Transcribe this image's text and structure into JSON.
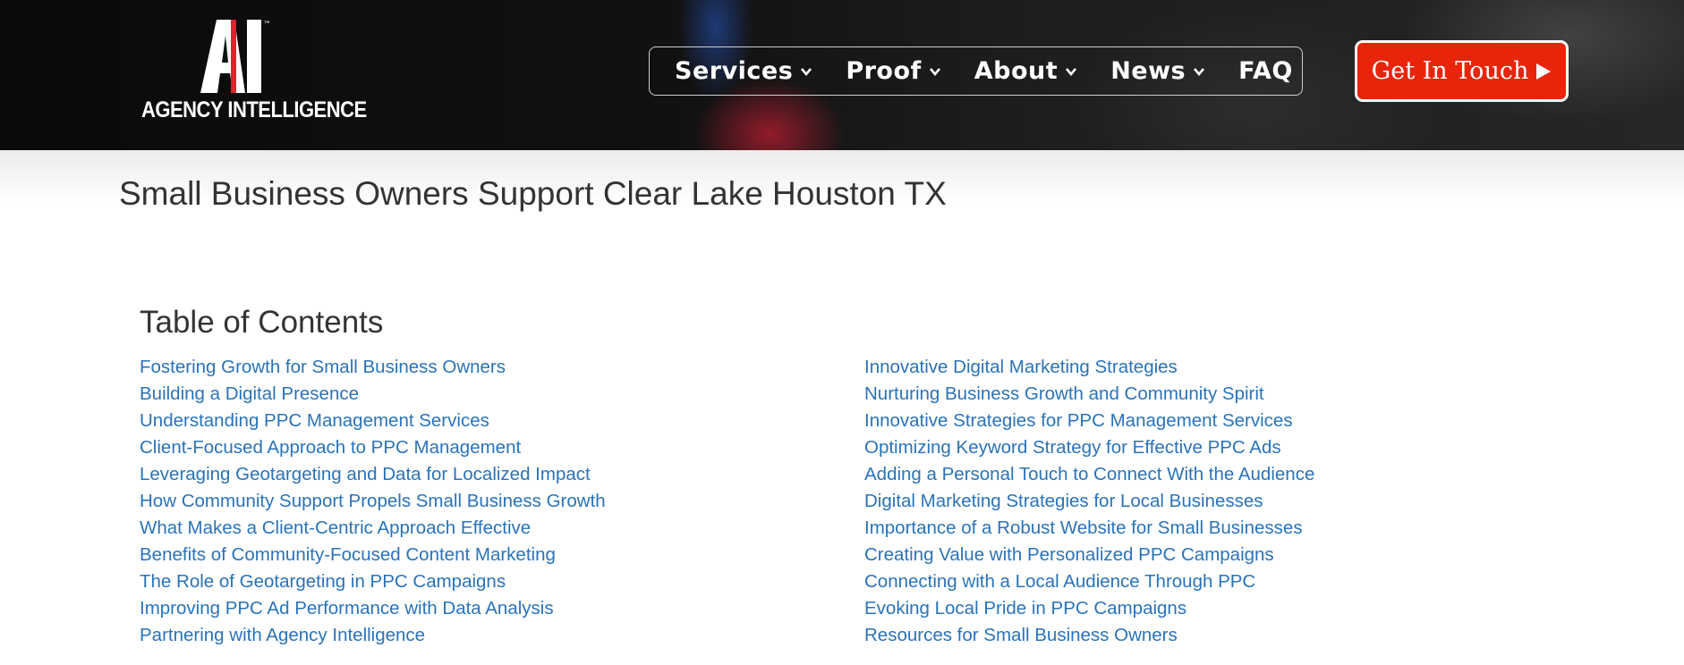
{
  "header": {
    "logo_text": "AGENCY INTELLIGENCE",
    "logo_mark": "AI",
    "trademark": "™",
    "nav": [
      {
        "label": "Services",
        "has_dropdown": true
      },
      {
        "label": "Proof",
        "has_dropdown": true
      },
      {
        "label": "About",
        "has_dropdown": true
      },
      {
        "label": "News",
        "has_dropdown": true
      },
      {
        "label": "FAQ",
        "has_dropdown": false
      }
    ],
    "cta_label": "Get In Touch",
    "cta_icon": "play-icon"
  },
  "main": {
    "page_title": "Small Business Owners Support Clear Lake Houston TX",
    "toc_heading": "Table of Contents",
    "toc_left": [
      "Fostering Growth for Small Business Owners",
      "Building a Digital Presence",
      "Understanding PPC Management Services",
      "Client-Focused Approach to PPC Management",
      "Leveraging Geotargeting and Data for Localized Impact",
      "How Community Support Propels Small Business Growth",
      "What Makes a Client-Centric Approach Effective",
      "Benefits of Community-Focused Content Marketing",
      "The Role of Geotargeting in PPC Campaigns",
      "Improving PPC Ad Performance with Data Analysis",
      "Partnering with Agency Intelligence"
    ],
    "toc_right": [
      "Innovative Digital Marketing Strategies",
      "Nurturing Business Growth and Community Spirit",
      "Innovative Strategies for PPC Management Services",
      "Optimizing Keyword Strategy for Effective PPC Ads",
      "Adding a Personal Touch to Connect With the Audience",
      "Digital Marketing Strategies for Local Businesses",
      "Importance of a Robust Website for Small Businesses",
      "Creating Value with Personalized PPC Campaigns",
      "Connecting with a Local Audience Through PPC",
      "Evoking Local Pride in PPC Campaigns",
      "Resources for Small Business Owners"
    ]
  },
  "colors": {
    "accent": "#e8250b",
    "link": "#2a73b8",
    "text": "#333333",
    "header_bg": "#111111"
  }
}
